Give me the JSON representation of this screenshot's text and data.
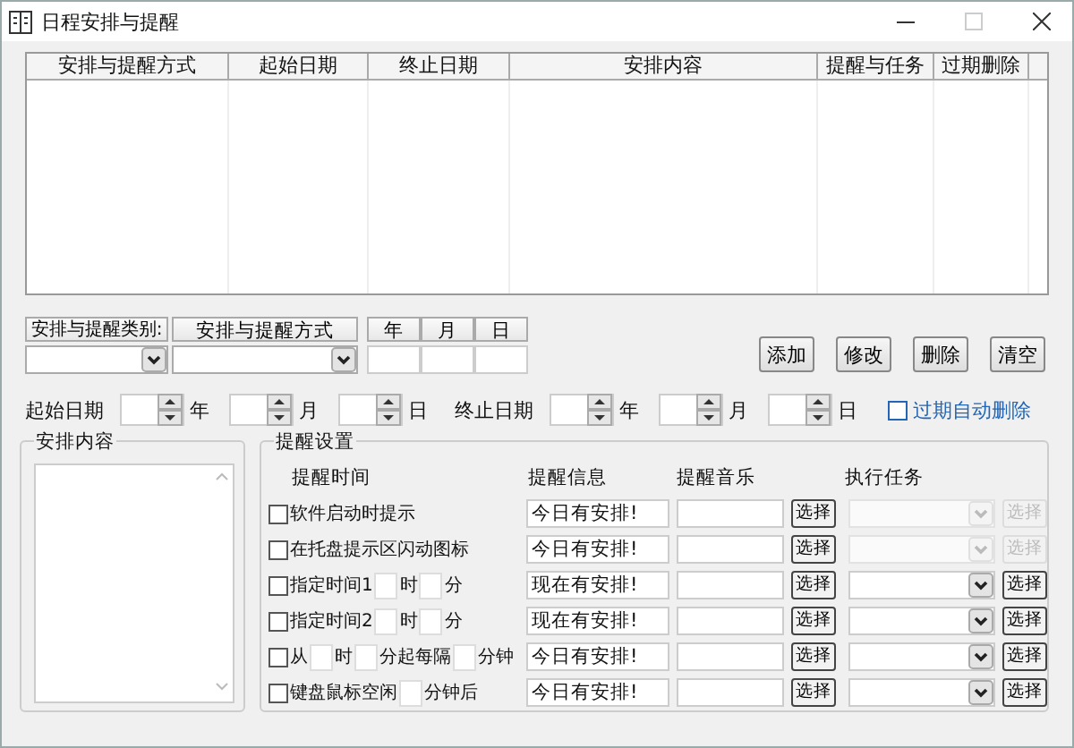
{
  "window": {
    "title": "日程安排与提醒"
  },
  "table": {
    "columns": [
      "安排与提醒方式",
      "起始日期",
      "终止日期",
      "安排内容",
      "提醒与任务",
      "过期删除"
    ]
  },
  "filter": {
    "category_label": "安排与提醒类别:",
    "method_label": "安排与提醒方式",
    "date_headers": [
      "年",
      "月",
      "日"
    ]
  },
  "buttons": [
    "添加",
    "修改",
    "删除",
    "清空"
  ],
  "date_range": {
    "start_label": "起始日期",
    "start_units": [
      "年",
      "月",
      "日"
    ],
    "end_label": "终止日期",
    "end_units": [
      "年",
      "月",
      "日"
    ],
    "auto_delete": {
      "label": "过期自动删除",
      "checked": false
    }
  },
  "content_group": {
    "title": "安排内容"
  },
  "reminder_group": {
    "title": "提醒设置",
    "columns": [
      "提醒时间",
      "提醒信息",
      "提醒音乐",
      "执行任务"
    ],
    "rows": [
      {
        "checked": false,
        "parts": [
          {
            "kind": "label",
            "text": "软件启动时提示"
          }
        ],
        "message": "今日有安排!",
        "music_button": "选择",
        "task_disabled": true,
        "task_button": "选择"
      },
      {
        "checked": false,
        "parts": [
          {
            "kind": "label",
            "text": "在托盘提示区闪动图标"
          }
        ],
        "message": "今日有安排!",
        "music_button": "选择",
        "task_disabled": true,
        "task_button": "选择"
      },
      {
        "checked": false,
        "parts": [
          {
            "kind": "label",
            "text": "指定时间1"
          },
          {
            "kind": "field"
          },
          {
            "kind": "label",
            "text": "时"
          },
          {
            "kind": "field"
          },
          {
            "kind": "label",
            "text": "分"
          }
        ],
        "message": "现在有安排!",
        "music_button": "选择",
        "task_disabled": false,
        "task_button": "选择"
      },
      {
        "checked": false,
        "parts": [
          {
            "kind": "label",
            "text": "指定时间2"
          },
          {
            "kind": "field"
          },
          {
            "kind": "label",
            "text": "时"
          },
          {
            "kind": "field"
          },
          {
            "kind": "label",
            "text": "分"
          }
        ],
        "message": "现在有安排!",
        "music_button": "选择",
        "task_disabled": false,
        "task_button": "选择"
      },
      {
        "checked": false,
        "parts": [
          {
            "kind": "label",
            "text": "从"
          },
          {
            "kind": "field"
          },
          {
            "kind": "label",
            "text": "时"
          },
          {
            "kind": "field"
          },
          {
            "kind": "label",
            "text": "分起每隔"
          },
          {
            "kind": "field"
          },
          {
            "kind": "label",
            "text": "分钟"
          }
        ],
        "message": "今日有安排!",
        "music_button": "选择",
        "task_disabled": false,
        "task_button": "选择"
      },
      {
        "checked": false,
        "parts": [
          {
            "kind": "label",
            "text": "键盘鼠标空闲"
          },
          {
            "kind": "field"
          },
          {
            "kind": "label",
            "text": "分钟后"
          }
        ],
        "message": "今日有安排!",
        "music_button": "选择",
        "task_disabled": false,
        "task_button": "选择"
      }
    ]
  }
}
